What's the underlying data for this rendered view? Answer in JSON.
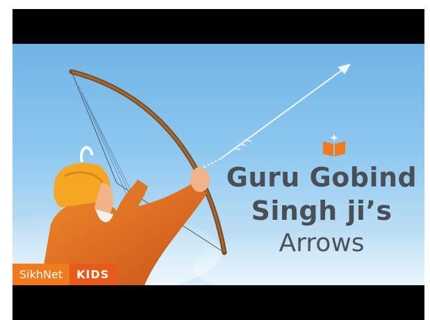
{
  "video": {
    "title_line1": "Guru Gobind",
    "title_line2": "Singh ji’s",
    "title_line3": "Arrows"
  },
  "brand": {
    "name": "SikhNet",
    "tag": "KIDS"
  },
  "colors": {
    "sky_top": "#6fb4e6",
    "sky_bottom": "#d9eefb",
    "title_text": "#4a4f55",
    "brand_orange": "#f07a1c",
    "kids_orange": "#e85a1a",
    "robe_orange": "#e8721c",
    "turban_yellow": "#f5a623"
  },
  "icons": {
    "book": "open-book-icon"
  }
}
